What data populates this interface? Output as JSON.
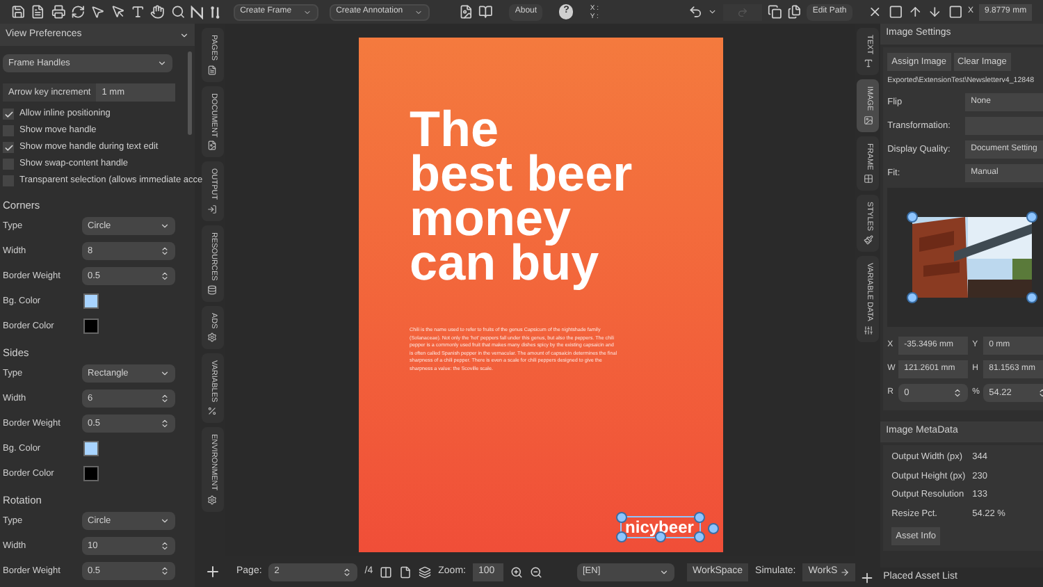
{
  "toolbar": {
    "dropdowns": [
      "Create Frame",
      "Create Annotation"
    ],
    "about": "About",
    "help": "?",
    "coord_x": "X :",
    "coord_y": "Y :",
    "edit_path": "Edit Path",
    "x_label": "X",
    "x_value": "9.8779 mm"
  },
  "left_panel": {
    "title": "View Preferences",
    "preset": "Frame Handles",
    "arrow_key": {
      "label": "Arrow key increment",
      "value": "1 mm"
    },
    "options": [
      {
        "label": "Allow inline positioning",
        "checked": true
      },
      {
        "label": "Show move handle",
        "checked": false
      },
      {
        "label": "Show move handle during text edit",
        "checked": true
      },
      {
        "label": "Show swap-content handle",
        "checked": false
      },
      {
        "label": "Transparent selection (allows immediate acce",
        "checked": false
      }
    ],
    "sections": [
      {
        "title": "Corners",
        "rows": [
          {
            "kind": "select",
            "label": "Type",
            "value": "Circle"
          },
          {
            "kind": "spin",
            "label": "Width",
            "value": "8"
          },
          {
            "kind": "spin",
            "label": "Border Weight",
            "value": "0.5"
          },
          {
            "kind": "color",
            "label": "Bg. Color",
            "color": "#a8d4ff"
          },
          {
            "kind": "color",
            "label": "Border Color",
            "color": "#000000"
          }
        ]
      },
      {
        "title": "Sides",
        "rows": [
          {
            "kind": "select",
            "label": "Type",
            "value": "Rectangle"
          },
          {
            "kind": "spin",
            "label": "Width",
            "value": "6"
          },
          {
            "kind": "spin",
            "label": "Border Weight",
            "value": "0.5"
          },
          {
            "kind": "color",
            "label": "Bg. Color",
            "color": "#a8d4ff"
          },
          {
            "kind": "color",
            "label": "Border Color",
            "color": "#000000"
          }
        ]
      },
      {
        "title": "Rotation",
        "rows": [
          {
            "kind": "select",
            "label": "Type",
            "value": "Circle"
          },
          {
            "kind": "spin",
            "label": "Width",
            "value": "10"
          },
          {
            "kind": "spin",
            "label": "Border Weight",
            "value": "0.5"
          }
        ]
      }
    ]
  },
  "left_tabs": [
    {
      "label": "PAGES"
    },
    {
      "label": "DOCUMENT"
    },
    {
      "label": "OUTPUT"
    },
    {
      "label": "RESOURCES"
    },
    {
      "label": "ADS"
    },
    {
      "label": "VARIABLES"
    },
    {
      "label": "ENVIRONMENT"
    }
  ],
  "poster": {
    "headline": [
      "The",
      "best beer",
      "money",
      "can buy"
    ],
    "body": "Chili is the name used to refer to fruits of the genus Capsicum of the nightshade family (Solanaceae). Not only the 'hot' peppers fall under this genus, but also the peppers. The chili pepper is a commonly used fruit that makes many dishes spicy by the existing capsaicin and is often called Spanish pepper in the vernacular. The amount of capsaicin determines the final sharpness of a chili pepper. There is even a scale for chili peppers designed to give the sharpness a value: the Scoville scale.",
    "logo": "nicybeer"
  },
  "bottom_bar": {
    "page_label": "Page:",
    "page": "2",
    "page_total": "/4",
    "zoom_label": "Zoom:",
    "zoom": "100",
    "language": "[EN]",
    "workspace": "WorkSpace",
    "simulate_label": "Simulate:",
    "simulate": "WorkS"
  },
  "right_tabs": [
    {
      "label": "TEXT",
      "selected": false
    },
    {
      "label": "IMAGE",
      "selected": true
    },
    {
      "label": "FRAME",
      "selected": false
    },
    {
      "label": "STYLES",
      "selected": false
    },
    {
      "label": "VARIABLE DATA",
      "selected": false
    }
  ],
  "image_settings": {
    "title": "Image Settings",
    "buttons": [
      "Assign Image",
      "Clear Image"
    ],
    "path": "Exported\\ExtensionTest\\Newsletterv4_12848",
    "fields": [
      {
        "label": "Flip",
        "value": "None"
      },
      {
        "label": "Transformation:"
      },
      {
        "label": "Display Quality:",
        "value": "Document Setting"
      },
      {
        "label": "Fit:",
        "value": "Manual"
      }
    ],
    "geometry": [
      {
        "label": "X",
        "value": "-35.3496 mm"
      },
      {
        "label": "Y",
        "value": "0 mm"
      },
      {
        "label": "W",
        "value": "121.2601 mm"
      },
      {
        "label": "H",
        "value": "81.1563 mm"
      },
      {
        "label": "R",
        "value": "0"
      },
      {
        "label": "%",
        "value": "54.22"
      }
    ]
  },
  "metadata": {
    "title": "Image MetaData",
    "rows": [
      {
        "label": "Output Width (px)",
        "value": "344"
      },
      {
        "label": "Output Height (px)",
        "value": "230"
      },
      {
        "label": "Output Resolution",
        "value": "133"
      },
      {
        "label": "Resize Pct.",
        "value": "54.22 %"
      }
    ],
    "button": "Asset Info"
  },
  "placed_assets": {
    "title": "Placed Asset List"
  }
}
